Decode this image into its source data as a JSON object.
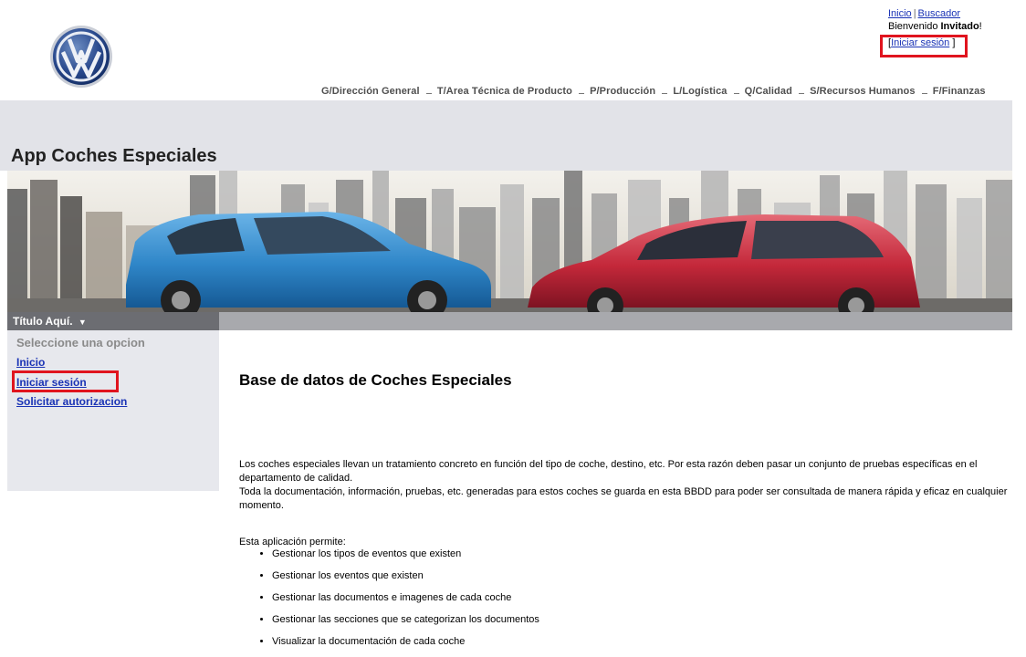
{
  "header": {
    "top_links": {
      "home": "Inicio",
      "separator": "|",
      "search": "Buscador"
    },
    "welcome_prefix": "Bienvenido ",
    "welcome_user": "Invitado",
    "welcome_suffix": "!",
    "login_open": "[",
    "login_link": "Iniciar sesión",
    "login_close": " ]"
  },
  "topmenu": [
    "G/Dirección General",
    "T/Area Técnica de Producto",
    "P/Producción",
    "L/Logística",
    "Q/Calidad",
    "S/Recursos Humanos",
    "F/Finanzas"
  ],
  "app": {
    "title": "App Coches Especiales"
  },
  "subnav": {
    "title": "Título Aquí.",
    "arrow": "▼"
  },
  "sidebar": {
    "hint": "Seleccione una opcion",
    "links": [
      "Inicio",
      "Iniciar sesión",
      "Solicitar autorizacion"
    ]
  },
  "main": {
    "title": "Base de datos de Coches Especiales",
    "paragraph1": "Los coches especiales llevan un tratamiento concreto en función del tipo de coche, destino, etc. Por esta razón deben pasar un conjunto de pruebas específicas en el departamento de calidad.",
    "paragraph2": "Toda la documentación, información, pruebas, etc. generadas para estos coches se guarda en esta BBDD para poder ser consultada de manera rápida y eficaz en cualquier momento.",
    "intro": "Esta aplicación permite:",
    "features": [
      "Gestionar los tipos de eventos que existen",
      "Gestionar los eventos que existen",
      "Gestionar las documentos e imagenes de cada coche",
      "Gestionar las secciones que se categorizan los documentos",
      "Visualizar la documentación de cada coche"
    ]
  },
  "colors": {
    "highlight": "#e0141e",
    "link": "#1a33b5",
    "car_blue": "#2f86c8",
    "car_red": "#c4283a"
  }
}
